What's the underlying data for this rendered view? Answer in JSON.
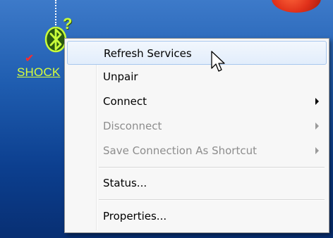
{
  "desktop": {
    "device_label": "SHOCK",
    "status_question": "?",
    "status_check": "✔",
    "accent_color": "#d8ff3a"
  },
  "icons": {
    "device": "bluetooth-icon",
    "pointer": "mouse-cursor-icon"
  },
  "context_menu": {
    "items": [
      {
        "label": "Refresh Services",
        "enabled": true,
        "submenu": false,
        "hovered": true
      },
      {
        "label": "Unpair",
        "enabled": true,
        "submenu": false
      },
      {
        "label": "Connect",
        "enabled": true,
        "submenu": true
      },
      {
        "label": "Disconnect",
        "enabled": false,
        "submenu": true
      },
      {
        "label": "Save Connection As Shortcut",
        "enabled": false,
        "submenu": true
      },
      {
        "label": "Status...",
        "enabled": true,
        "submenu": false
      },
      {
        "label": "Properties...",
        "enabled": true,
        "submenu": false
      }
    ]
  }
}
